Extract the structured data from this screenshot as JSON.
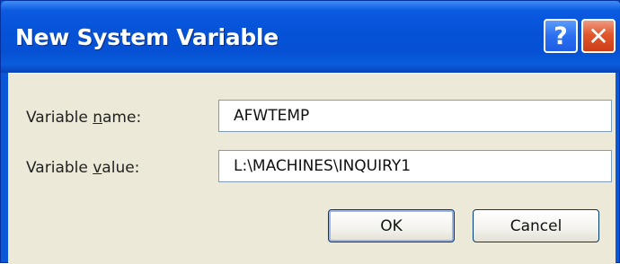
{
  "window": {
    "title": "New System Variable",
    "help_button": "?",
    "close_button": "✕"
  },
  "form": {
    "name_label_pre": "Variable ",
    "name_label_u": "n",
    "name_label_post": "ame:",
    "name_value": "AFWTEMP",
    "value_label_pre": "Variable ",
    "value_label_u": "v",
    "value_label_post": "alue:",
    "value_value": "L:\\MACHINES\\INQUIRY1"
  },
  "buttons": {
    "ok_label": "OK",
    "cancel_label": "Cancel"
  },
  "colors": {
    "title_bar": "#0653d8",
    "dialog_face": "#ece9d8",
    "close_button": "#e2582e",
    "help_button": "#2b6ff1"
  },
  "icons": {
    "help": "help-icon",
    "close": "close-icon"
  }
}
